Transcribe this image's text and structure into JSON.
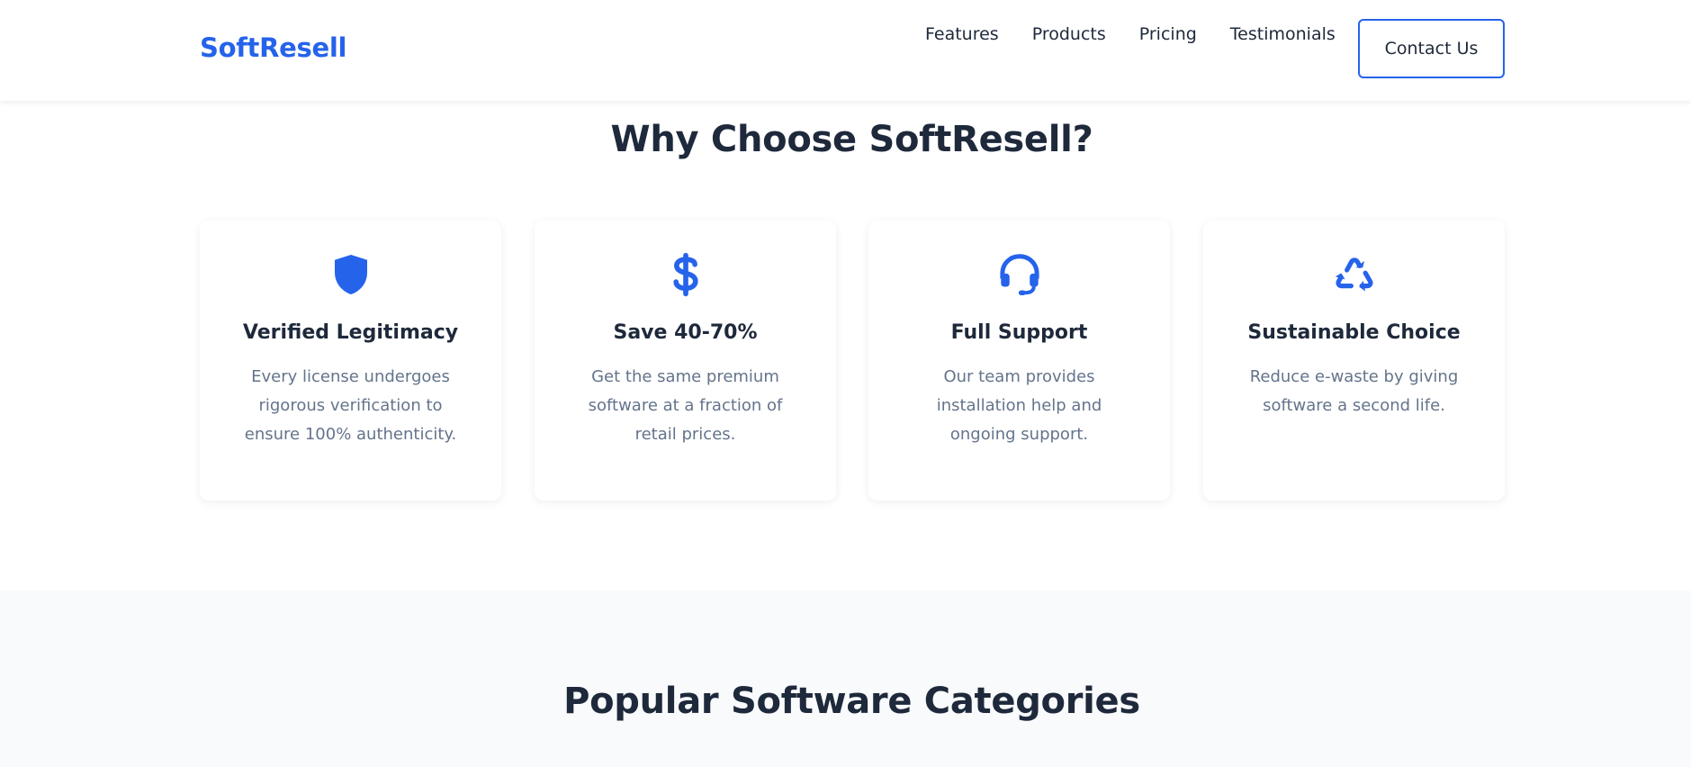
{
  "header": {
    "logo": "SoftResell",
    "nav": [
      "Features",
      "Products",
      "Pricing",
      "Testimonials"
    ],
    "contact_label": "Contact Us"
  },
  "why": {
    "title": "Why Choose SoftResell?",
    "cards": [
      {
        "icon": "shield-icon",
        "title": "Verified Legitimacy",
        "text": "Every license undergoes rigorous verification to ensure 100% authenticity."
      },
      {
        "icon": "dollar-icon",
        "title": "Save 40-70%",
        "text": "Get the same premium software at a fraction of retail prices."
      },
      {
        "icon": "headset-icon",
        "title": "Full Support",
        "text": "Our team provides installation help and ongoing support."
      },
      {
        "icon": "recycle-icon",
        "title": "Sustainable Choice",
        "text": "Reduce e-waste by giving software a second life."
      }
    ]
  },
  "categories": {
    "title": "Popular Software Categories"
  },
  "colors": {
    "accent": "#2563eb",
    "text": "#1e293b",
    "muted": "#64748b",
    "section_bg": "#f8fafc"
  }
}
